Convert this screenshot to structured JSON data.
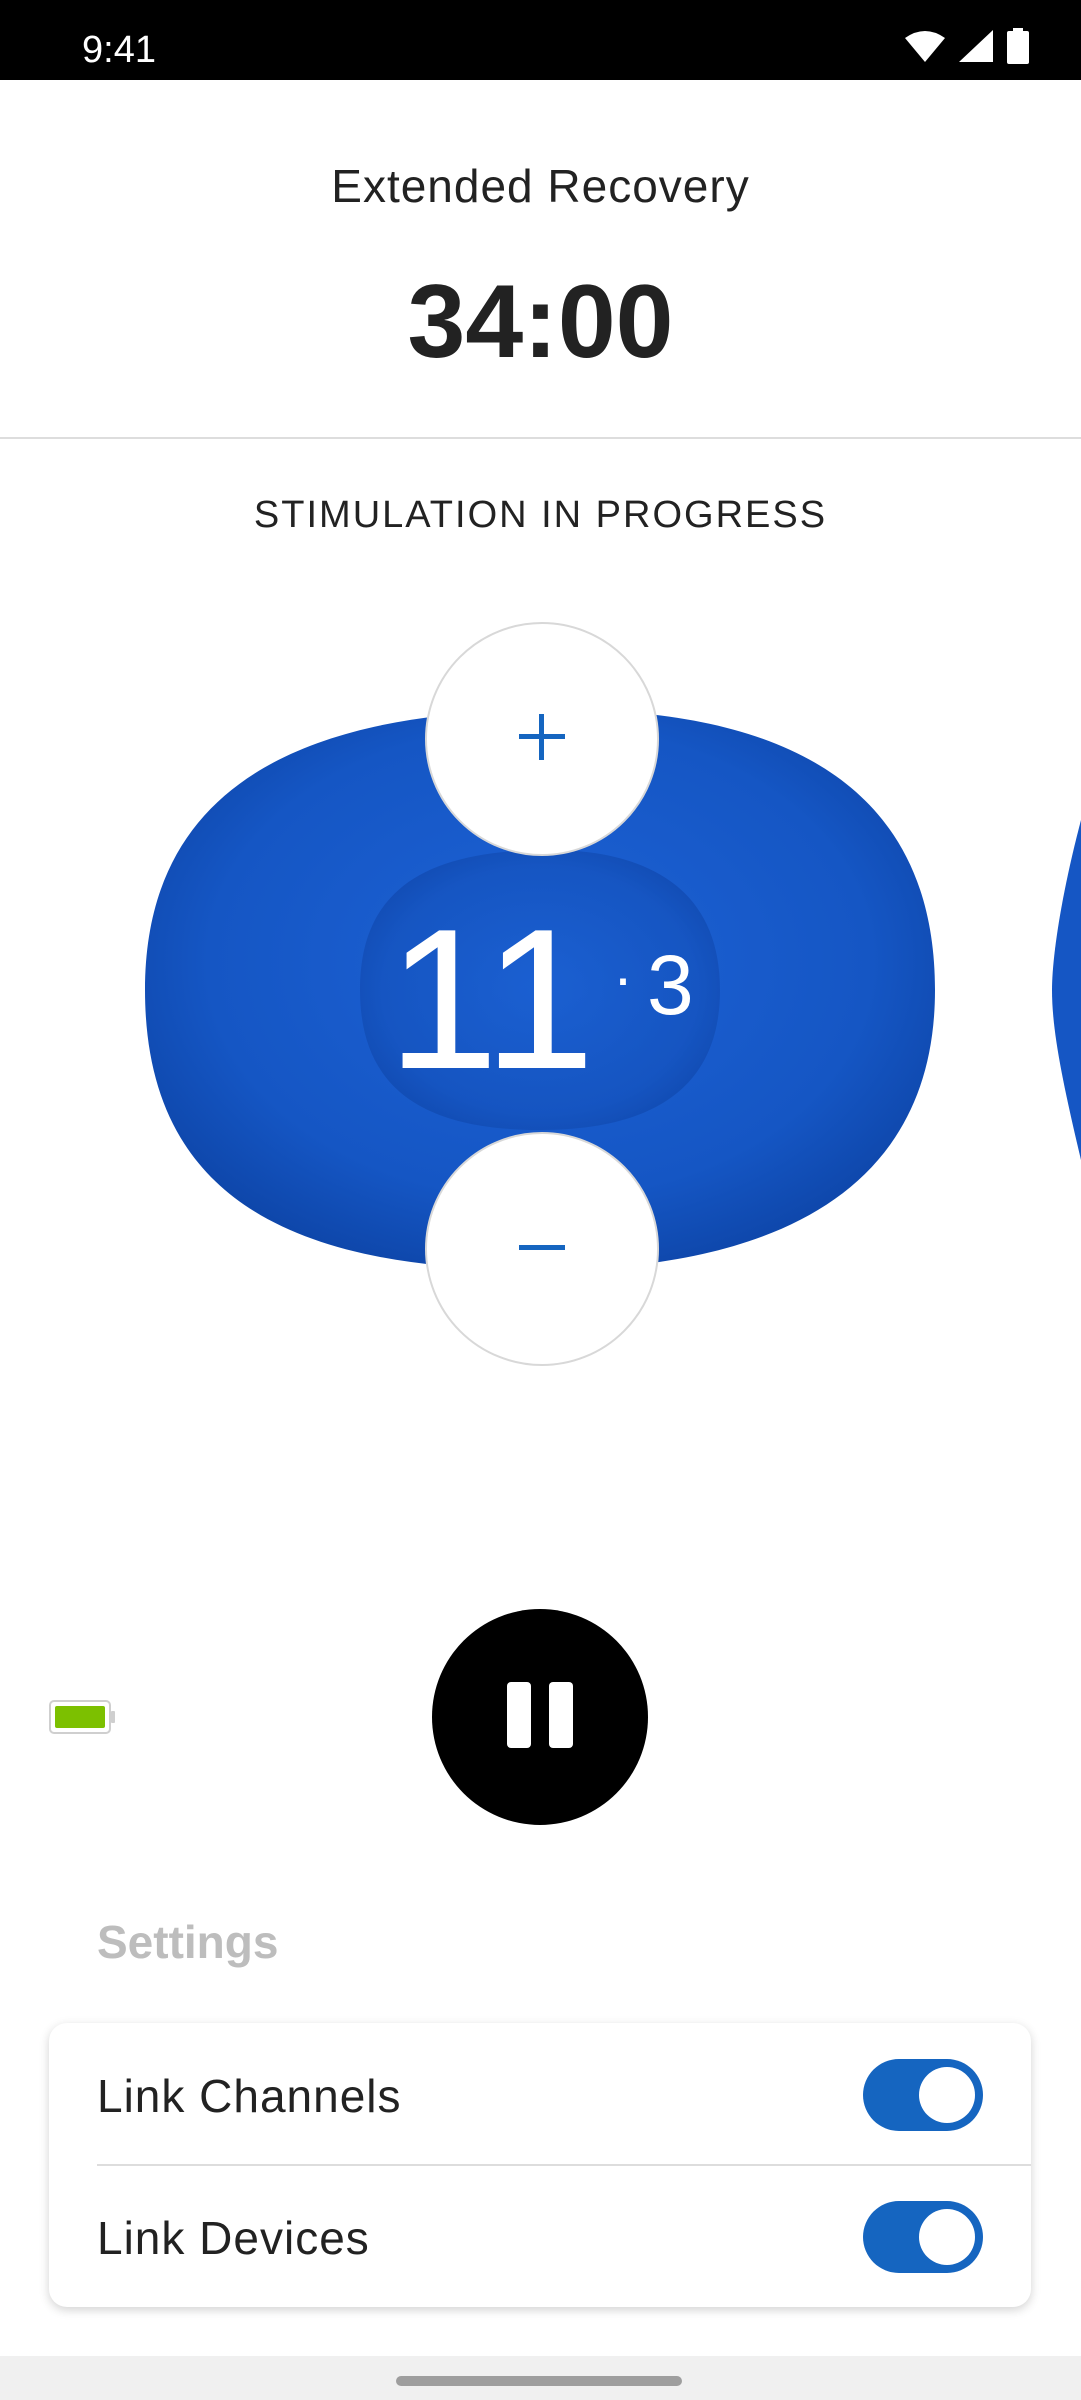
{
  "status_bar": {
    "time": "9:41",
    "icons": [
      "wifi-icon",
      "cellular-signal-icon",
      "battery-icon"
    ]
  },
  "program": {
    "title": "Extended Recovery",
    "timer": "34:00"
  },
  "stimulation": {
    "status": "STIMULATION IN PROGRESS",
    "intensity_main": "11",
    "intensity_sub": "3",
    "pad_color": "#1556c4",
    "increase_icon": "plus-icon",
    "decrease_icon": "minus-icon"
  },
  "device_battery": {
    "icon": "battery-icon",
    "color": "#7cc000"
  },
  "controls": {
    "pause_icon": "pause-icon"
  },
  "settings": {
    "heading": "Settings",
    "items": [
      {
        "label": "Link Channels",
        "enabled": true
      },
      {
        "label": "Link Devices",
        "enabled": true
      }
    ],
    "toggle_color": "#1565c0"
  }
}
